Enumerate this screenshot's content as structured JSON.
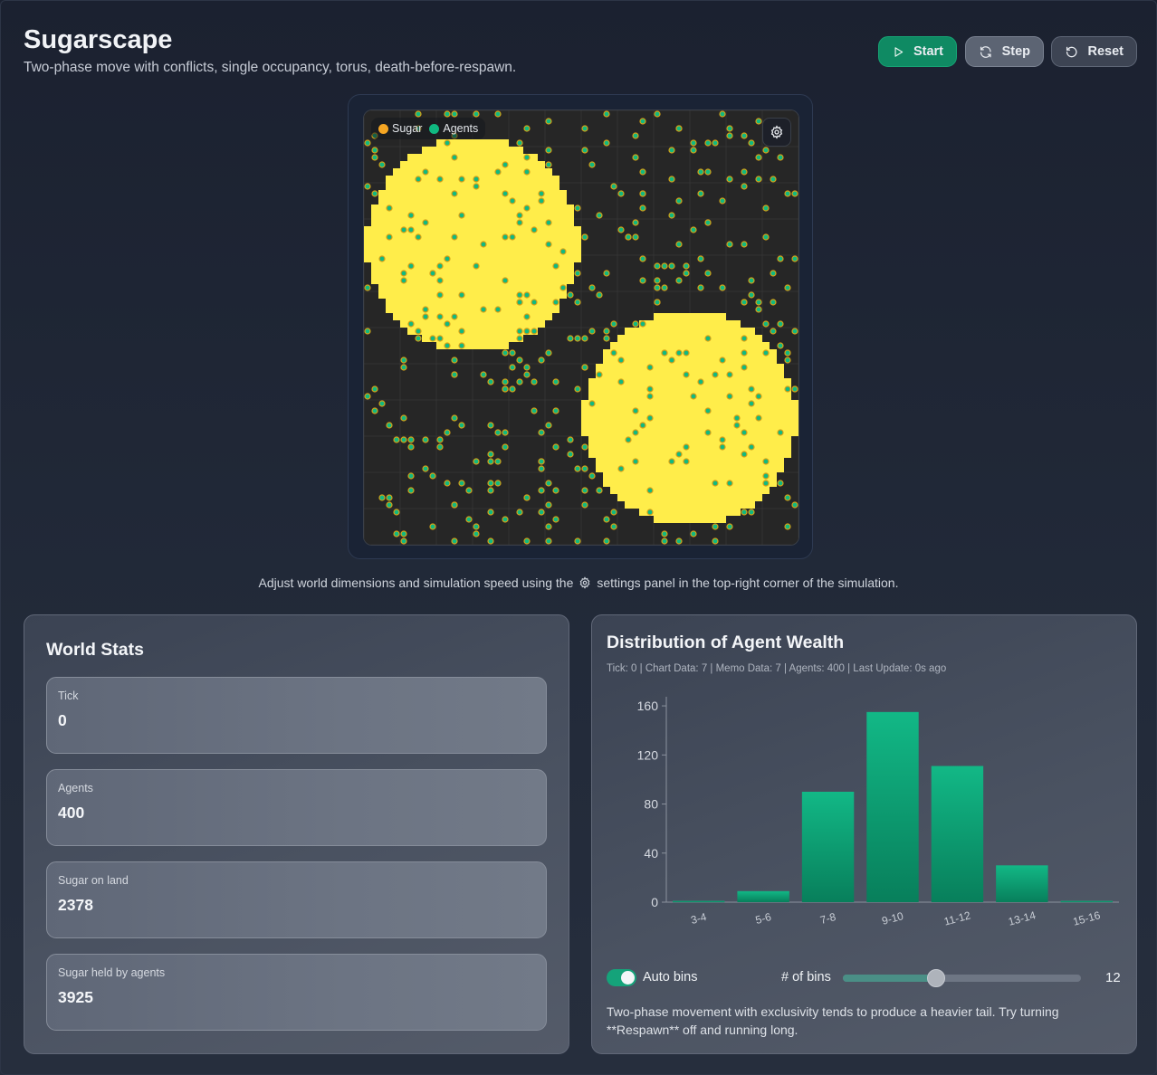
{
  "header": {
    "title": "Sugarscape",
    "subtitle": "Two-phase move with conflicts, single occupancy, torus, death-before-respawn."
  },
  "toolbar": {
    "start_label": "Start",
    "step_label": "Step",
    "reset_label": "Reset"
  },
  "simulation": {
    "legend": [
      {
        "label": "Sugar",
        "color": "#f5a623"
      },
      {
        "label": "Agents",
        "color": "#10b981"
      }
    ],
    "colors": {
      "background": "#262626",
      "sugar": "#ffed4a",
      "agent_fill": "#10b981",
      "agent_ring": "#d4a017"
    },
    "settings_icon": "gear-icon"
  },
  "hint": {
    "before": "Adjust world dimensions and simulation speed using the",
    "after": "settings panel in the top-right corner of the simulation."
  },
  "world_stats": {
    "title": "World Stats",
    "items": [
      {
        "label": "Tick",
        "value": "0"
      },
      {
        "label": "Agents",
        "value": "400"
      },
      {
        "label": "Sugar on land",
        "value": "2378"
      },
      {
        "label": "Sugar held by agents",
        "value": "3925"
      }
    ]
  },
  "wealth": {
    "title": "Distribution of Agent Wealth",
    "meta": "Tick: 0 | Chart Data: 7 | Memo Data: 7 | Agents: 400 | Last Update: 0s ago",
    "auto_bins_label": "Auto bins",
    "auto_bins_on": true,
    "bins_label": "# of bins",
    "bins_value": "12",
    "bins_slider_fraction": 0.39,
    "note": "Two-phase movement with exclusivity tends to produce a heavier tail. Try turning **Respawn** off and running long."
  },
  "chart_data": {
    "type": "bar",
    "categories": [
      "3-4",
      "5-6",
      "7-8",
      "9-10",
      "11-12",
      "13-14",
      "15-16"
    ],
    "values": [
      1,
      9,
      90,
      155,
      111,
      30,
      1
    ],
    "yticks": [
      0,
      40,
      80,
      120,
      160
    ],
    "ylim": [
      0,
      163
    ],
    "xlabel": "",
    "ylabel": "",
    "bar_color_top": "#12b886",
    "bar_color_bottom": "#087f5b"
  }
}
